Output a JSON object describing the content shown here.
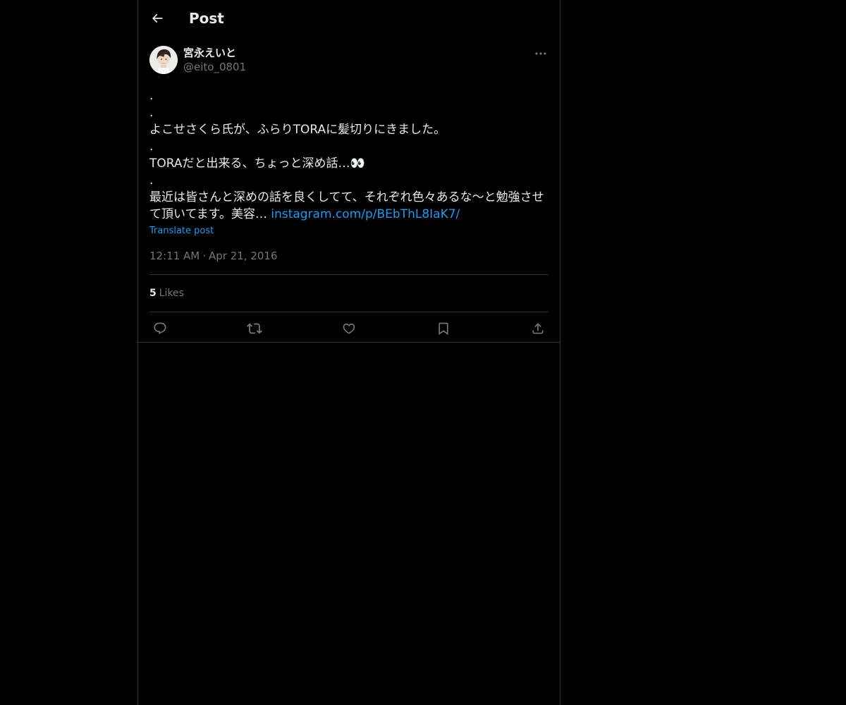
{
  "header": {
    "title": "Post",
    "back_icon": "arrow-left-icon"
  },
  "post": {
    "author": {
      "name": "宮永えいと",
      "handle": "@eito_0801",
      "avatar_icon": "user-avatar"
    },
    "body": {
      "dot1": ".",
      "dot2": ".",
      "line1": "よこせさくら氏が、ふらりTORAに髪切りにきました。",
      "dot3": ".",
      "line2": "TORAだと出来る、ちょっと深め話…👀",
      "dot4": ".",
      "line3": "最近は皆さんと深めの話を良くしてて、それぞれ色々あるな〜と勉強させ",
      "line4_text": "て頂いてます。美容… ",
      "link": "instagram.com/p/BEbThL8IaK7/"
    },
    "translate_label": "Translate post",
    "time": "12:11 AM",
    "separator": "·",
    "date": "Apr 21, 2016",
    "likes_count": "5",
    "likes_label": "Likes"
  },
  "actions": {
    "reply_icon": "reply-icon",
    "repost_icon": "repost-icon",
    "like_icon": "heart-icon",
    "bookmark_icon": "bookmark-icon",
    "share_icon": "share-icon"
  },
  "colors": {
    "background": "#000000",
    "text": "#e7e9ea",
    "muted": "#71767b",
    "accent": "#1d9bf0",
    "border": "#2f3336"
  }
}
